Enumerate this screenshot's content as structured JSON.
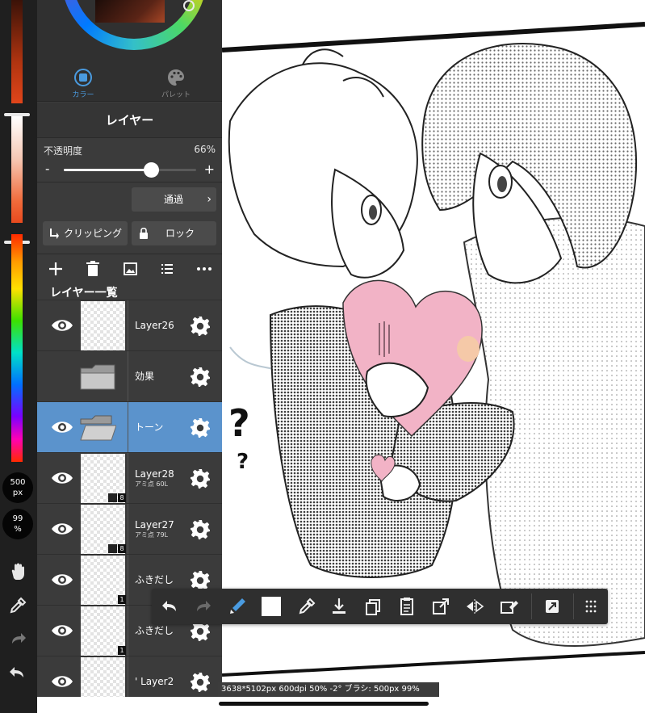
{
  "left_toolbar": {
    "brush_size": "500",
    "brush_size_unit": "px",
    "brush_opacity": "99",
    "brush_opacity_unit": "%",
    "icons": [
      "hand-icon",
      "eyedropper-icon",
      "redo-icon",
      "undo-icon"
    ]
  },
  "color_panel": {
    "tabs": [
      {
        "label": "カラー",
        "icon": "color-icon",
        "active": true
      },
      {
        "label": "パレット",
        "icon": "palette-icon",
        "active": false
      }
    ]
  },
  "layer_panel": {
    "title": "レイヤー",
    "opacity_label": "不透明度",
    "opacity_value": "66%",
    "opacity_fraction": 0.66,
    "minus": "-",
    "plus": "+",
    "blend_mode": "通過",
    "clipping_label": "クリッピング",
    "lock_label": "ロック",
    "list_title": "レイヤー一覧",
    "toolbar_icons": [
      "add-layer-icon",
      "delete-layer-icon",
      "image-icon",
      "list-icon",
      "more-icon"
    ],
    "layers": [
      {
        "name": "Layer26",
        "sub": "",
        "visible": true,
        "type": "layer",
        "selected": false,
        "badge": ""
      },
      {
        "name": "効果",
        "sub": "",
        "visible": false,
        "type": "folder",
        "selected": false,
        "badge": ""
      },
      {
        "name": "トーン",
        "sub": "",
        "visible": true,
        "type": "folder",
        "selected": true,
        "badge": ""
      },
      {
        "name": "Layer28",
        "sub": "アミ点 60L",
        "visible": true,
        "type": "layer",
        "selected": false,
        "badge": "8"
      },
      {
        "name": "Layer27",
        "sub": "アミ点 79L",
        "visible": true,
        "type": "layer",
        "selected": false,
        "badge": "8"
      },
      {
        "name": "ふきだし",
        "sub": "",
        "visible": true,
        "type": "layer",
        "selected": false,
        "badge": "1"
      },
      {
        "name": "ふきだし",
        "sub": "",
        "visible": true,
        "type": "layer",
        "selected": false,
        "badge": "1"
      },
      {
        "name": "' Layer2",
        "sub": "",
        "visible": true,
        "type": "layer",
        "selected": false,
        "badge": ""
      }
    ]
  },
  "bottom_toolbar": {
    "icons": [
      "undo-icon",
      "redo-icon",
      "swap-color-icon",
      "color-swatch",
      "eyedropper-icon",
      "download-icon",
      "duplicate-icon",
      "paste-icon",
      "export-icon",
      "flip-icon",
      "eraser-icon",
      "transform-icon",
      "grid-icon"
    ]
  },
  "status_bar": {
    "text": "3638*5102px 600dpi 50% -2° ブラシ: 500px 99%"
  },
  "colors": {
    "selected_row": "#5b93cc",
    "accent": "#4a9be0",
    "heart": "#f2b3c6"
  }
}
